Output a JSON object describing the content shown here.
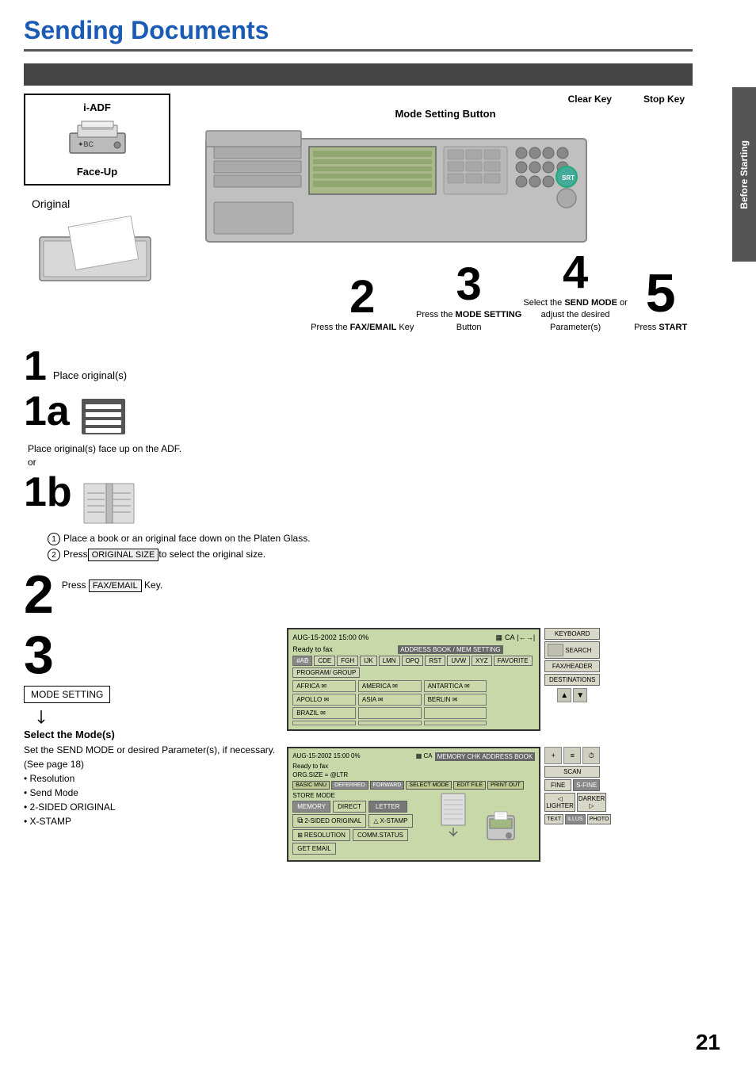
{
  "title": "Sending Documents",
  "sidebar": {
    "label": "Before Starting"
  },
  "page_number": "21",
  "header_labels": {
    "clear_key": "Clear Key",
    "stop_key": "Stop Key",
    "mode_setting": "Mode Setting Button"
  },
  "diagram": {
    "iadf_label": "i-ADF",
    "face_up_label": "Face-Up",
    "original_label": "Original"
  },
  "steps": {
    "step1": {
      "number": "1",
      "label": "Place original(s)"
    },
    "step1a": {
      "label": "1a",
      "text": "Place original(s) face up on the ADF.",
      "or_text": "or"
    },
    "step1b": {
      "label": "1b",
      "instruction1": "Place a book or an original face down on the Platen Glass.",
      "instruction2": "Press  ORIGINAL SIZE  to select the original size.",
      "original_size_btn": "ORIGINAL SIZE"
    },
    "step2": {
      "number": "2",
      "text": "Press  FAX/EMAIL  Key.",
      "fax_email_btn": "FAX/EMAIL"
    },
    "step3": {
      "number": "3",
      "mode_setting_label": "MODE SETTING",
      "select_mode_title": "Select the Mode(s)",
      "description": "Set  the SEND MODE or desired Parameter(s), if necessary.",
      "see_page": "(See page 18)",
      "bullets": [
        "• Resolution",
        "• Send Mode",
        "• 2-SIDED ORIGINAL",
        "• X-STAMP"
      ]
    },
    "step4": {
      "number": "4",
      "text": "Select the",
      "bold_text": "SEND MODE",
      "text2": "or adjust the desired Parameter(s)"
    },
    "step5": {
      "number": "5",
      "text": "Press",
      "bold_text": "START"
    }
  },
  "lcd1": {
    "date_time": "AUG-15-2002  15:00  0%",
    "status": "Ready to fax",
    "tabs": [
      "#AB",
      "CDE",
      "FGH",
      "IJK",
      "LMN",
      "OPQ",
      "RST",
      "UVW",
      "XYZ",
      "FAVORITE",
      "PROGRAM/ GROUP"
    ],
    "rows": [
      [
        "AFRICA",
        "AMERICA",
        "ANTARTICA"
      ],
      [
        "APOLLO",
        "ASIA",
        "BERLIN"
      ],
      [
        "BRAZIL",
        "",
        ""
      ]
    ],
    "sidebar_buttons": [
      "KEYBOARD",
      "SEARCH",
      "FAX/HEADER",
      "DESTINATIONS"
    ]
  },
  "lcd2": {
    "date_time": "AUG-15-2002  15:00  0%",
    "status": "Ready to fax",
    "org_size": "ORG.SIZE = @LTR",
    "top_tabs": [
      "BASIC MNU",
      "DEFERRED",
      "FORWARD",
      "SELECT MODE",
      "EDIT FILE",
      "PRINT OUT"
    ],
    "store_mode": "STORE MODE",
    "buttons_row1": [
      "MEMORY",
      "DIRECT",
      "LETTER"
    ],
    "buttons_row2": [
      "2-SIDED ORIGINAL",
      "X-STAMP"
    ],
    "buttons_row3": [
      "RESOLUTION",
      "COMM.STATUS"
    ],
    "buttons_row4": [
      "GET EMAIL"
    ],
    "sidebar_buttons": [
      "SCAN",
      "FINE",
      "S-FINE",
      "LIGHTER",
      "DARKER"
    ],
    "right_icons": [
      "TEXT",
      "ILLUSTRATION",
      "PHOTO"
    ]
  }
}
